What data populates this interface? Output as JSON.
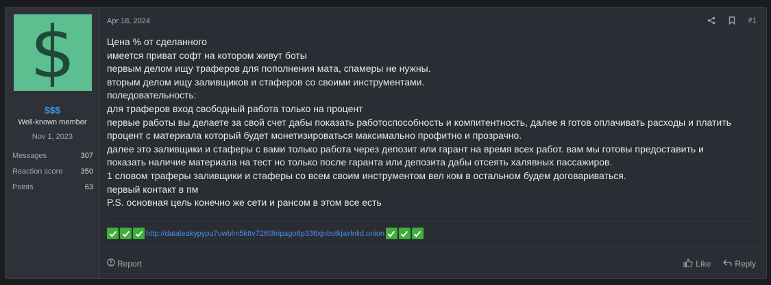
{
  "user": {
    "avatar_symbol": "$",
    "avatar_bg": "#5dbf8f",
    "name": "$$$",
    "title": "Well-known member",
    "joined": "Nov 1, 2023",
    "stats": [
      {
        "label": "Messages",
        "value": "307"
      },
      {
        "label": "Reaction score",
        "value": "350"
      },
      {
        "label": "Points",
        "value": "63"
      }
    ]
  },
  "post": {
    "date": "Apr 18, 2024",
    "number": "#1",
    "lines": [
      "Цена % от сделанного",
      "имеется приват софт на котором живут боты",
      "первым делом ищу траферов для пополнения мата, спамеры не нужны.",
      "вторым делом ищу заливщиков и стаферов со своими инструментами.",
      "поледовательность:",
      "для траферов вход свободный работа только на процент",
      "первые работы вы делаете за свой счет дабы показать работоспособность и компитентность, далее я готов оплачивать расходы и платить",
      "процент с материала который будет монетизироваться максимально профитно и прозрачно.",
      "далее это заливщики и стаферы с вами только работа через депозит или гарант на время всех работ. вам мы готовы предоставить и",
      "показать наличие материала на тест но только после гаранта или депозита дабы отсеять халявных пассажиров.",
      "1 словом траферы заливщики и стаферы со всем своим инструментом вел ком в остальном будем договариваться.",
      "первый контакт в пм",
      "P.S. основная цель конечно же сети и рансом в этом все есть"
    ],
    "link": "http://dataleakypypu7uwblm5kttv726l3iripago6p336xjnbstkjwrlnlid.onion"
  },
  "actions": {
    "report": "Report",
    "like": "Like",
    "reply": "Reply"
  },
  "icons": [
    "share-icon",
    "bookmark-icon",
    "report-icon",
    "like-icon",
    "reply-icon",
    "checkmark-icon"
  ],
  "colors": {
    "username": "#3d8ee3",
    "link": "#4a8fe6",
    "checkmark_bg": "#3fae3a"
  }
}
